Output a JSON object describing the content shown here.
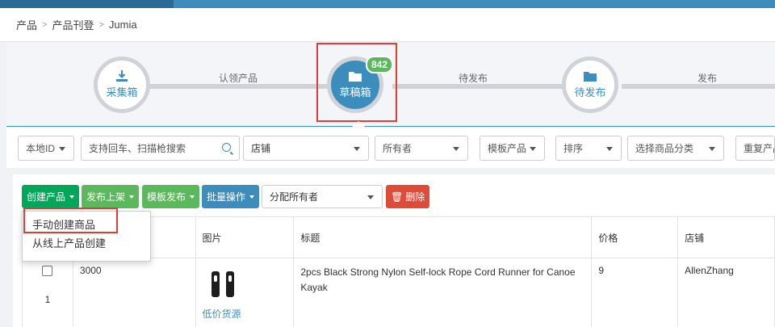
{
  "breadcrumb": {
    "items": [
      "产品",
      "产品刊登",
      "Jumia"
    ]
  },
  "workflow": {
    "nodes": [
      {
        "label": "采集箱",
        "icon": "download-icon"
      },
      {
        "label": "草稿箱",
        "icon": "folder-icon",
        "badge": "842"
      },
      {
        "label": "待发布",
        "icon": "folder-icon"
      }
    ],
    "edge_labels": [
      "认领产品",
      "待发布",
      "发布"
    ]
  },
  "filters": {
    "local_id": "本地ID",
    "search_placeholder": "支持回车、扫描枪搜索",
    "shop": "店铺",
    "owner": "所有者",
    "template_product": "模板产品",
    "sort": "排序",
    "category": "选择商品分类",
    "duplicate": "重复产品"
  },
  "toolbar": {
    "create": "创建产品",
    "publish": "发布上架",
    "template_publish": "模板发布",
    "batch": "批量操作",
    "assign_owner": "分配所有者",
    "delete": "删除"
  },
  "create_menu": {
    "items": [
      "手动创建商品",
      "从线上产品创建"
    ]
  },
  "table": {
    "columns": [
      "",
      "",
      "图片",
      "标题",
      "价格",
      "店铺"
    ],
    "rows": [
      {
        "index": "1",
        "id": "3000",
        "image_link": "低价货源",
        "title": "2pcs Black Strong Nylon Self-lock Rope Cord Runner for Canoe Kayak",
        "price": "9",
        "shop": "AllenZhang"
      }
    ]
  },
  "colors": {
    "primary": "#3c8dbc",
    "success": "#00a65a",
    "success_light": "#5cb85c",
    "danger": "#dd4b39",
    "highlight": "#e53935"
  }
}
